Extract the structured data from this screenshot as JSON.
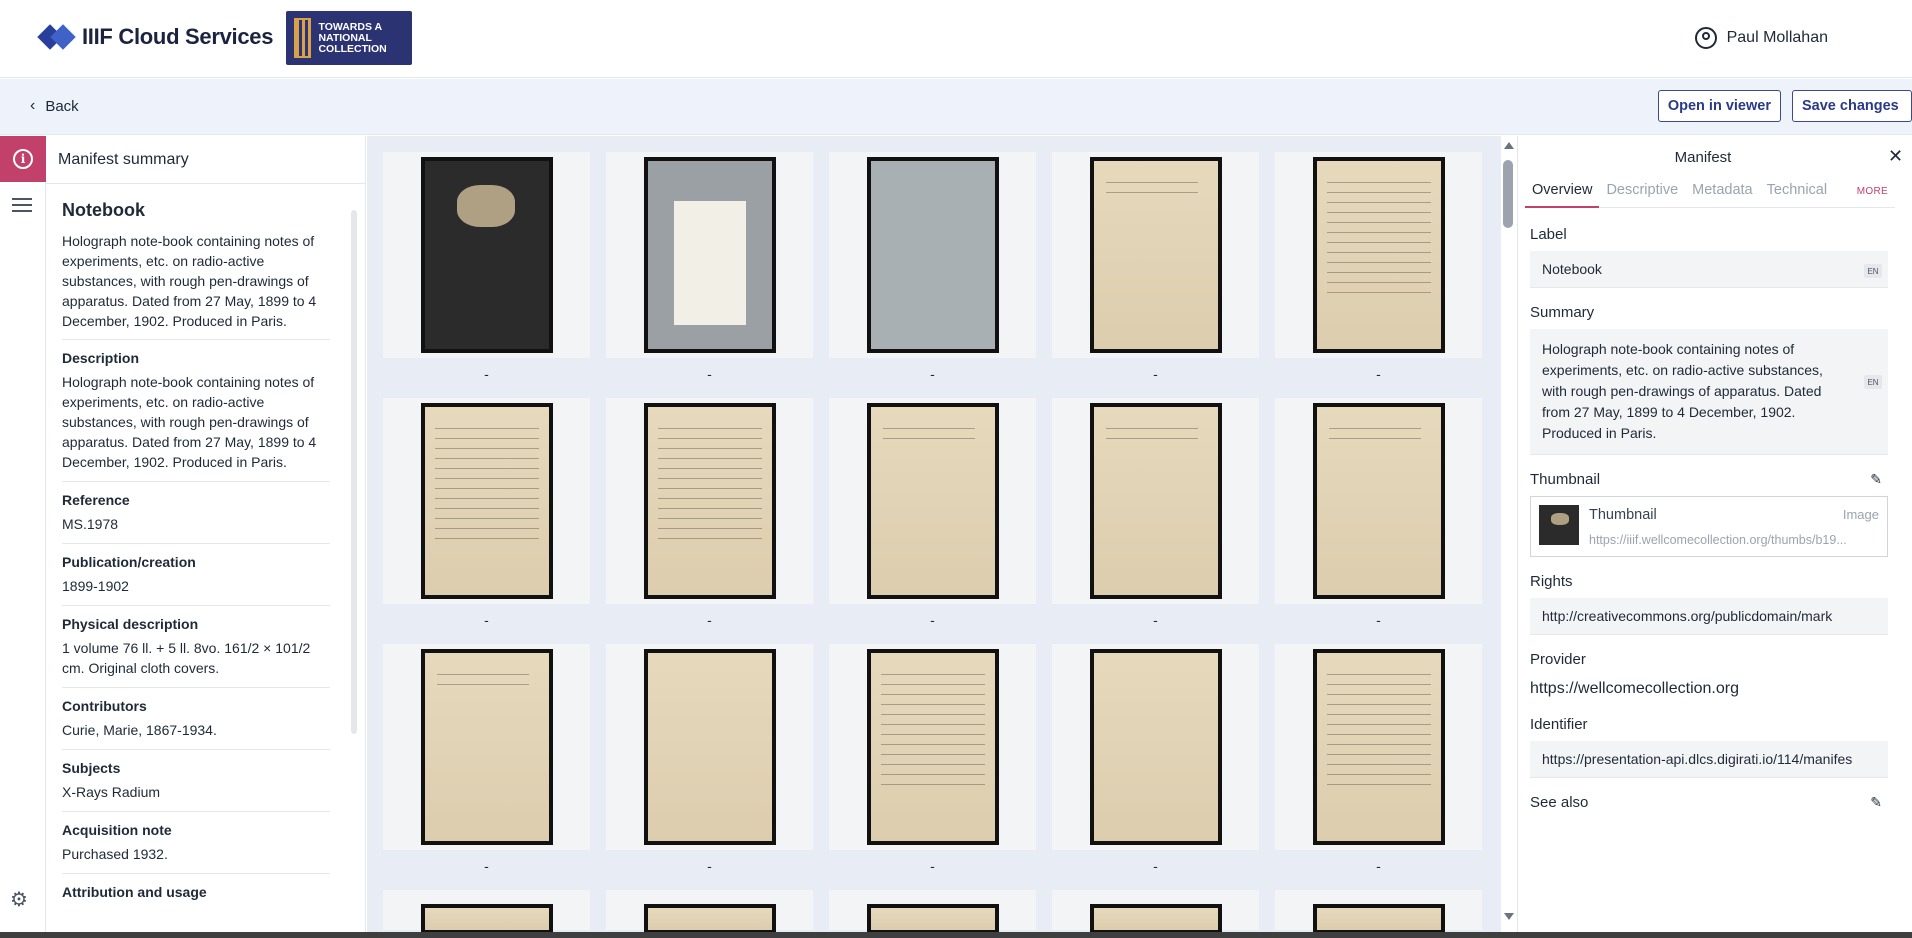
{
  "header": {
    "brand_name": "IIIF Cloud Services",
    "partner_logo_text": "TOWARDS A NATIONAL COLLECTION",
    "user_name": "Paul Mollahan"
  },
  "toolbar": {
    "back_label": "Back",
    "open_viewer_label": "Open in viewer",
    "save_label": "Save changes"
  },
  "summary": {
    "header": "Manifest summary",
    "title": "Notebook",
    "description": "Holograph note-book containing notes of experiments, etc. on radio-active substances, with rough pen-drawings of apparatus. Dated from 27 May, 1899 to 4 December, 1902. Produced in Paris.",
    "fields": [
      {
        "label": "Description",
        "value": "Holograph note-book containing notes of experiments, etc. on radio-active substances, with rough pen-drawings of apparatus. Dated from 27 May, 1899 to 4 December, 1902. Produced in Paris."
      },
      {
        "label": "Reference",
        "value": "MS.1978"
      },
      {
        "label": "Publication/creation",
        "value": "1899-1902"
      },
      {
        "label": "Physical description",
        "value": "1 volume 76 ll. + 5 ll. 8vo. 161/2 × 101/2 cm. Original cloth covers."
      },
      {
        "label": "Contributors",
        "value": "Curie, Marie, 1867-1934."
      },
      {
        "label": "Subjects",
        "value": "X-Rays Radium"
      },
      {
        "label": "Acquisition note",
        "value": "Purchased 1932."
      },
      {
        "label": "Attribution and usage",
        "value": ""
      }
    ]
  },
  "canvases": {
    "labels": [
      "-",
      "-",
      "-",
      "-",
      "-",
      "-",
      "-",
      "-",
      "-",
      "-",
      "-",
      "-",
      "-",
      "-",
      "-"
    ]
  },
  "manifest": {
    "title": "Manifest",
    "tabs": [
      "Overview",
      "Descriptive",
      "Metadata",
      "Technical"
    ],
    "more_label": "MORE",
    "label_heading": "Label",
    "label_value": "Notebook",
    "lang": "EN",
    "summary_heading": "Summary",
    "summary_value": "Holograph note-book containing notes of experiments, etc. on radio-active substances, with rough pen-drawings of apparatus. Dated from 27 May, 1899 to 4 December, 1902. Produced in Paris.",
    "thumbnail_heading": "Thumbnail",
    "thumbnail_title": "Thumbnail",
    "thumbnail_type": "Image",
    "thumbnail_url": "https://iiif.wellcomecollection.org/thumbs/b19...",
    "rights_heading": "Rights",
    "rights_value": "http://creativecommons.org/publicdomain/mark",
    "provider_heading": "Provider",
    "provider_value": "https://wellcomecollection.org",
    "identifier_heading": "Identifier",
    "identifier_value": "https://presentation-api.dlcs.digirati.io/114/manifes",
    "see_also_heading": "See also"
  }
}
